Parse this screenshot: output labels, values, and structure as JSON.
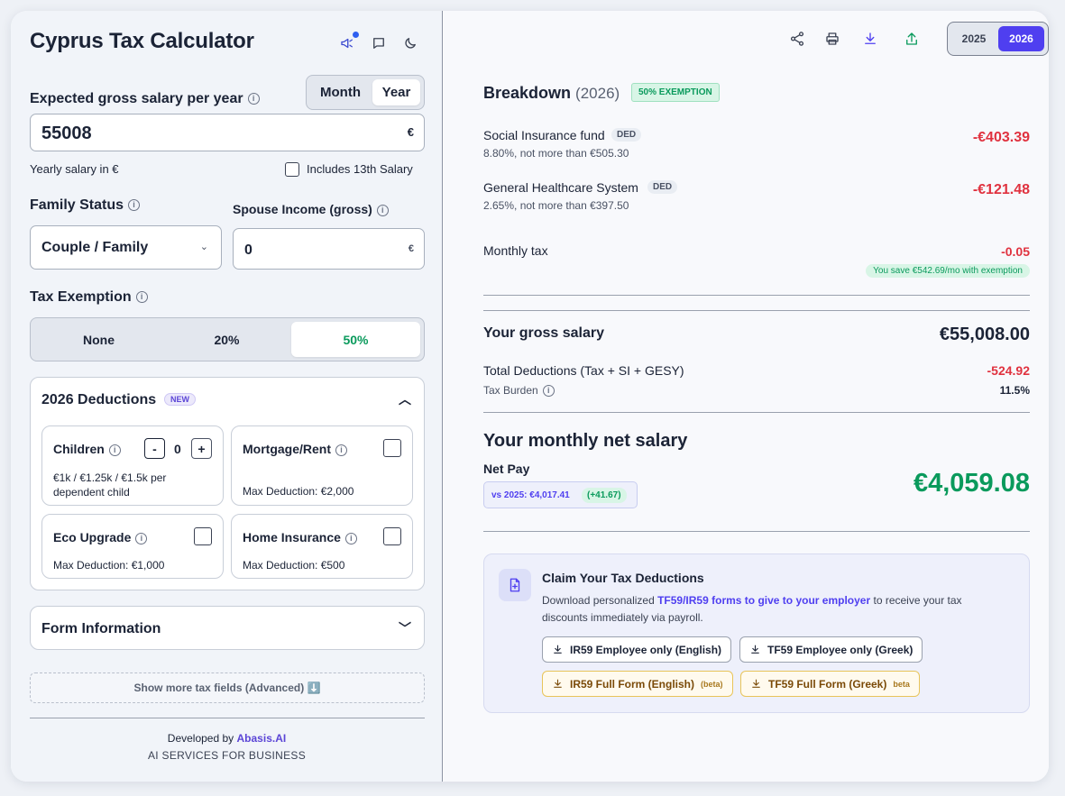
{
  "app": {
    "title": "Cyprus Tax Calculator"
  },
  "salary": {
    "label": "Expected gross salary per year",
    "value": "55008",
    "currency": "€",
    "helper": "Yearly salary in €",
    "include13_label": "Includes 13th Salary",
    "include13_checked": false,
    "period_options": [
      "Month",
      "Year"
    ],
    "period_selected": "Year"
  },
  "family": {
    "label": "Family Status",
    "selected": "Couple / Family",
    "spouse_label": "Spouse Income (gross)",
    "spouse_value": "0",
    "spouse_currency": "€"
  },
  "exemption": {
    "label": "Tax Exemption",
    "options": [
      "None",
      "20%",
      "50%"
    ],
    "selected": "50%"
  },
  "deductions": {
    "title": "2026 Deductions",
    "badge": "NEW",
    "children": {
      "label": "Children",
      "minus": "-",
      "count": "0",
      "plus": "+",
      "desc": "€1k / €1.25k / €1.5k per dependent child"
    },
    "mortgage": {
      "label": "Mortgage/Rent",
      "max": "Max Deduction: €2,000"
    },
    "eco": {
      "label": "Eco Upgrade",
      "max": "Max Deduction: €1,000"
    },
    "home": {
      "label": "Home Insurance",
      "max": "Max Deduction: €500"
    }
  },
  "form_info": {
    "title": "Form Information"
  },
  "advanced": {
    "label": "Show more tax fields (Advanced) ⬇️"
  },
  "footer": {
    "developed_by": "Developed by",
    "company": "Abasis.AI",
    "tagline": "AI SERVICES FOR BUSINESS"
  },
  "toolbar": {
    "years": [
      "2025",
      "2026"
    ],
    "selected_year": "2026"
  },
  "breakdown": {
    "title": "Breakdown",
    "year": "(2026)",
    "badge": "50% EXEMPTION",
    "si": {
      "label": "Social Insurance fund",
      "tag": "DED",
      "sub": "8.80%, not more than €505.30",
      "value": "-€403.39"
    },
    "gesy": {
      "label": "General Healthcare System",
      "tag": "DED",
      "sub": "2.65%, not more than €397.50",
      "value": "-€121.48"
    },
    "monthly_tax": {
      "label": "Monthly tax",
      "value": "-0.05",
      "saving": "You save €542.69/mo with exemption"
    },
    "gross": {
      "label": "Your gross salary",
      "value": "€55,008.00"
    },
    "total": {
      "label": "Total Deductions (Tax + SI + GESY)",
      "value": "-524.92"
    },
    "burden": {
      "label": "Tax Burden",
      "value": "11.5%"
    },
    "net": {
      "title": "Your monthly net salary",
      "label": "Net Pay",
      "vs": "vs 2025: €4,017.41",
      "diff": "(+41.67)",
      "value": "€4,059.08"
    }
  },
  "claim": {
    "title": "Claim Your Tax Deductions",
    "text_before": "Download personalized ",
    "text_bold": "TF59/IR59 forms to give to your employer",
    "text_after": " to receive your tax discounts immediately via payroll.",
    "buttons": [
      {
        "label": "IR59 Employee only (English)"
      },
      {
        "label": "TF59 Employee only (Greek)"
      },
      {
        "label": "IR59 Full Form (English)",
        "tag": "(beta)"
      },
      {
        "label": "TF59 Full Form (Greek)",
        "tag": "beta"
      }
    ]
  },
  "colors": {
    "accent": "#4f3ff0",
    "green": "#0a9a5c",
    "red": "#e0323f"
  }
}
